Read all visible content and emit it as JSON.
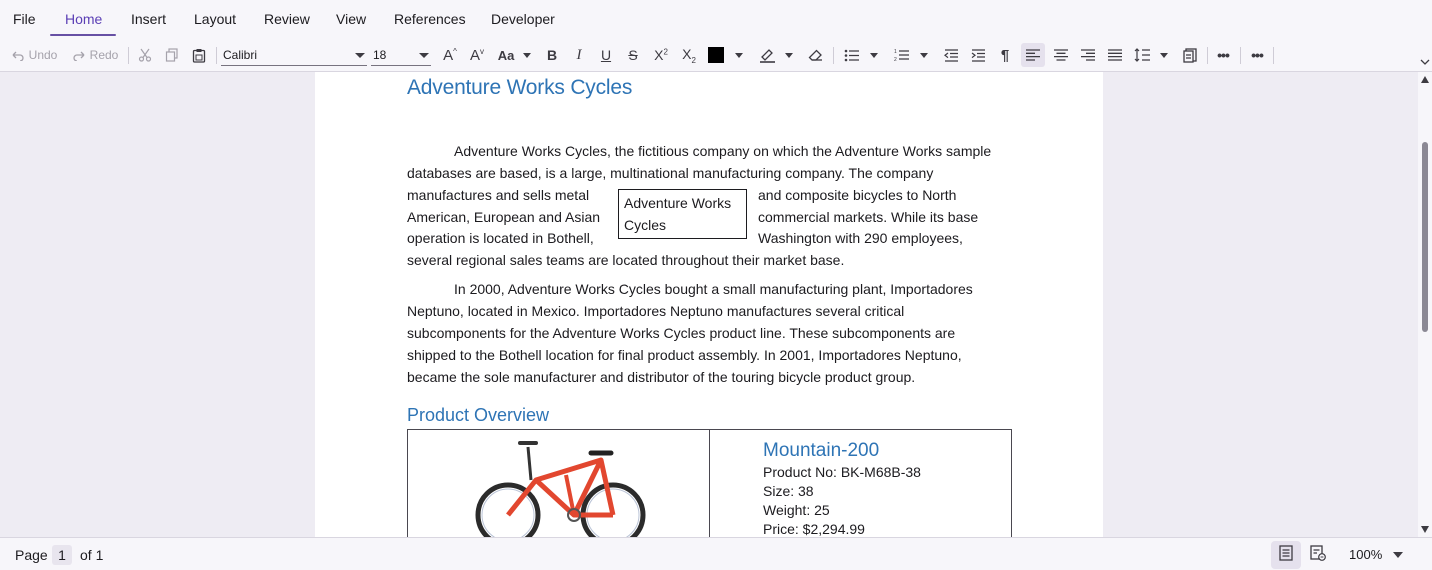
{
  "menu": {
    "tabs": [
      "File",
      "Home",
      "Insert",
      "Layout",
      "Review",
      "View",
      "References",
      "Developer"
    ],
    "active": "Home"
  },
  "toolbar": {
    "undo_label": "Undo",
    "redo_label": "Redo",
    "font_name": "Calibri",
    "font_size": "18",
    "change_case_label": "Aa",
    "font_color": "#000000",
    "icons": [
      "undo-icon",
      "redo-icon",
      "cut-icon",
      "copy-icon",
      "paste-icon",
      "grow-font-icon",
      "shrink-font-icon",
      "change-case-icon",
      "bold-icon",
      "italic-icon",
      "underline-icon",
      "strikethrough-icon",
      "superscript-icon",
      "subscript-icon",
      "font-color-icon",
      "highlight-icon",
      "clear-format-icon",
      "bullets-icon",
      "numbering-icon",
      "decrease-indent-icon",
      "increase-indent-icon",
      "paragraph-mark-icon",
      "align-left-icon",
      "align-center-icon",
      "align-right-icon",
      "justify-icon",
      "line-spacing-icon",
      "paragraph-settings-icon",
      "more-icon"
    ]
  },
  "document": {
    "title": "Adventure Works Cycles",
    "para1": [
      "Adventure Works Cycles, the fictitious company on which the Adventure Works sample",
      "databases are based, is a large, multinational manufacturing company. The company",
      "manufactures and sells metal",
      "and composite bicycles to North",
      "American, European and Asian",
      "commercial markets. While its base",
      "operation is located in Bothell,",
      "Washington with 290 employees,",
      "several regional sales teams are located throughout their market base."
    ],
    "textbox": [
      "Adventure Works",
      "Cycles"
    ],
    "para2": [
      "In 2000, Adventure Works Cycles bought a small manufacturing plant, Importadores",
      "Neptuno, located in Mexico. Importadores Neptuno manufactures several critical",
      "subcomponents for the Adventure Works Cycles product line. These subcomponents are",
      "shipped to the Bothell location for final product assembly. In 2001, Importadores Neptuno,",
      "became the sole manufacturer and distributor of the touring bicycle product group."
    ],
    "section_heading": "Product Overview",
    "product": {
      "name": "Mountain-200",
      "number": "Product No: BK-M68B-38",
      "size": "Size: 38",
      "weight": "Weight: 25",
      "price": "Price: $2,294.99"
    },
    "heading_color": "#2e74b5"
  },
  "status": {
    "page_label": "Page",
    "page_current": "1",
    "of_label": "of 1",
    "zoom": "100%"
  }
}
